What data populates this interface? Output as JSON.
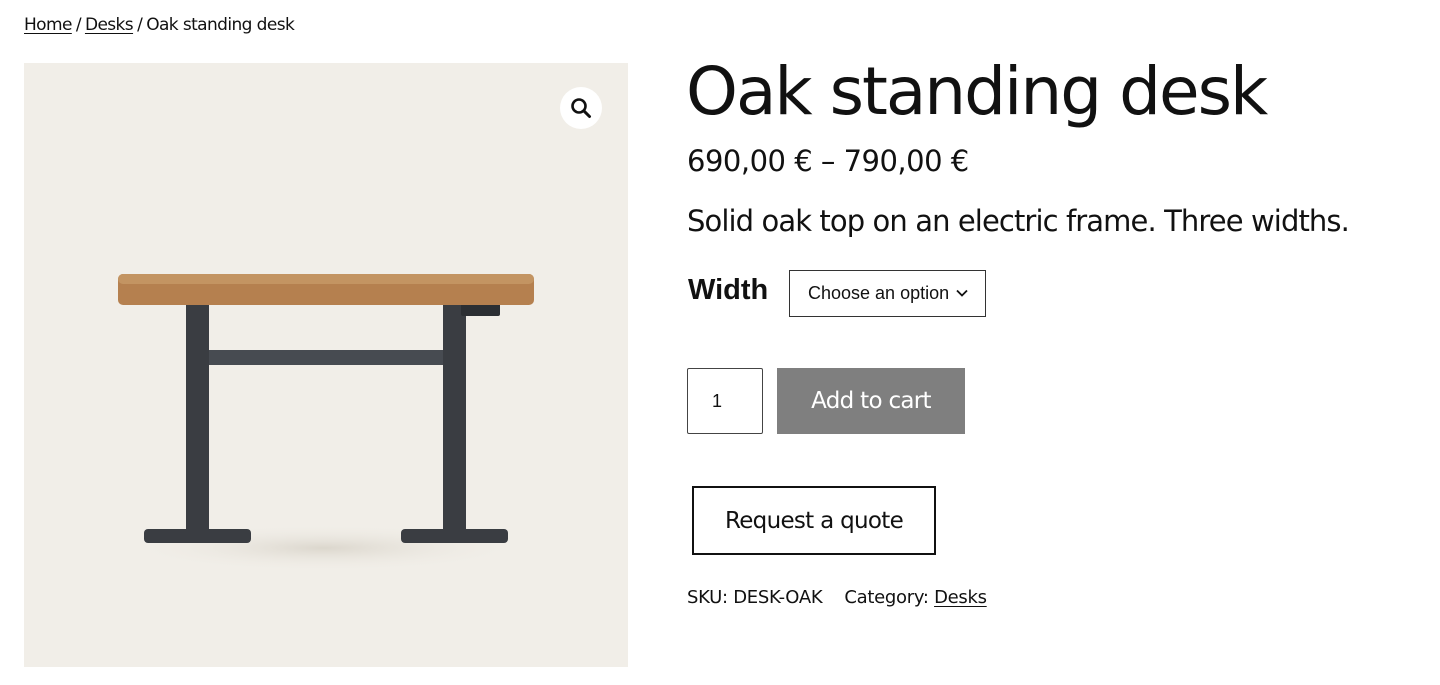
{
  "breadcrumb": {
    "home": "Home",
    "separator": "/",
    "category": "Desks",
    "current": "Oak standing desk"
  },
  "gallery": {
    "zoom_icon": "magnifier-icon",
    "image_subject": "oak standing desk",
    "colors": {
      "background": "#f1eee8",
      "oak_top": "#b88755",
      "frame": "#3a3d42"
    }
  },
  "product": {
    "title": "Oak standing desk",
    "price": "690,00 € – 790,00 €",
    "short_description": "Solid oak top on an electric frame. Three widths.",
    "variation_label": "Width",
    "variation_select": {
      "selected": "Choose an option",
      "icon": "chevron-down-icon"
    },
    "quantity": "1",
    "add_to_cart_label": "Add to cart",
    "request_quote_label": "Request a quote",
    "sku_label": "SKU:",
    "sku_value": "DESK-OAK",
    "category_label": "Category:",
    "category_value": "Desks"
  },
  "colors": {
    "add_to_cart_bg": "#7f7f7f",
    "text": "#111111"
  }
}
